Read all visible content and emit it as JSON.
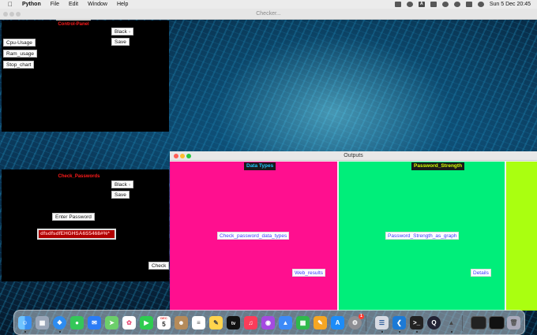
{
  "menubar": {
    "app_name": "Python",
    "items": [
      "File",
      "Edit",
      "Window",
      "Help"
    ],
    "clock": "Sun 5 Dec  20:45",
    "status_badge": "A"
  },
  "checker_window": {
    "title": "Checker...",
    "control_panel": {
      "header": "Control-Panel",
      "color_select": "Black",
      "save_label": "Save",
      "buttons": [
        "Cpu-Usage",
        "Ram_usage",
        "Stop_chart"
      ]
    },
    "check_passwords": {
      "header": "Check_Passwords",
      "color_select": "Black",
      "save_label": "Save",
      "enter_password_label": "Enter Password",
      "password_value": "dfsdfsdfEHGHSA6S5468#%*",
      "check_label": "Check"
    }
  },
  "outputs_window": {
    "title": "Outputs",
    "data_types": {
      "header": "Data Types",
      "check_button": "Check_password_data_types",
      "web_results_button": "Web_results",
      "bg_color": "#ff0f8f"
    },
    "password_strength": {
      "header": "Password_Strength",
      "graph_button": "Password_Strength_as_graph",
      "details_button": "Details",
      "bg_color": "#00ee7a"
    },
    "third_pane_color": "#aaff10"
  },
  "dock": {
    "apps": [
      "finder-icon",
      "launchpad-icon",
      "safari-icon",
      "messages-icon",
      "mail-icon",
      "maps-icon",
      "photos-icon",
      "facetime-icon",
      "calendar-icon",
      "contacts-icon",
      "reminders-icon",
      "notes-icon",
      "tv-icon",
      "music-icon",
      "podcasts-icon",
      "keynote-icon",
      "numbers-icon",
      "pages-icon",
      "appstore-icon",
      "settings-icon",
      "python-icon",
      "vscode-icon",
      "terminal-icon",
      "quicktime-icon",
      "python-launcher-icon",
      "window-thumb-1-icon",
      "window-thumb-2-icon",
      "trash-icon"
    ],
    "calendar_day": "5",
    "calendar_month": "DEC",
    "settings_badge": "1",
    "tv_label": "tv"
  }
}
